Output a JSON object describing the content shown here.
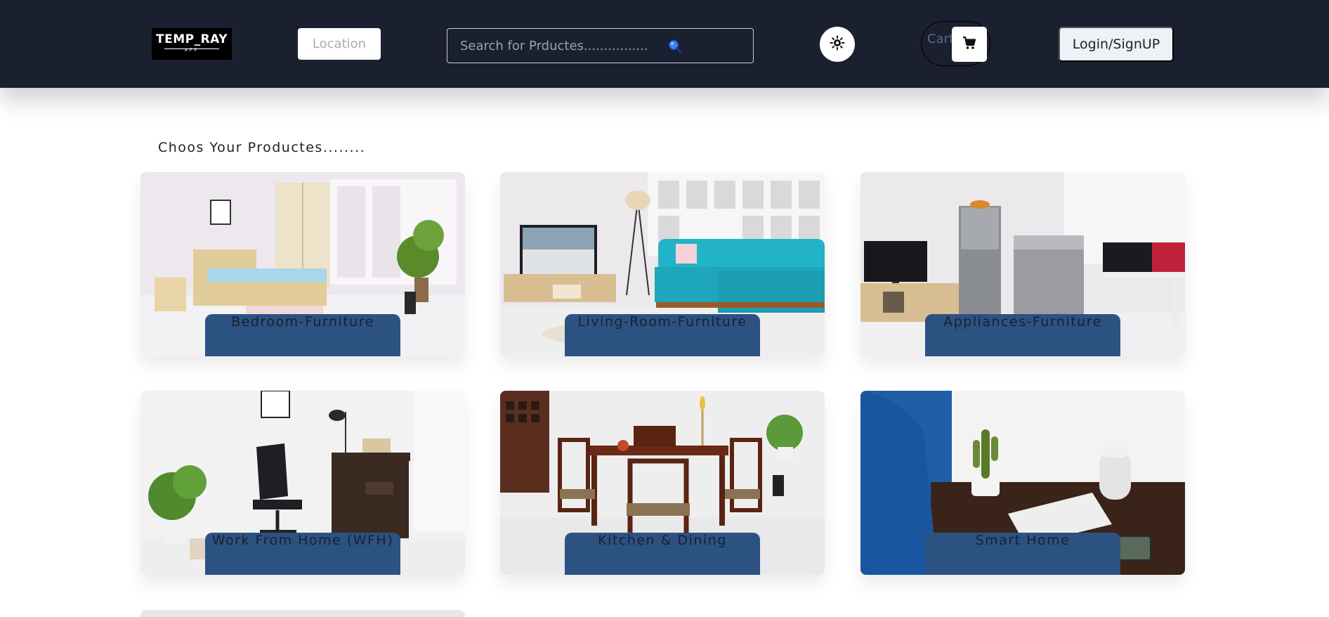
{
  "navbar": {
    "logo": {
      "text": "TEMP_RAY",
      "subtext": "APP"
    },
    "location_label": "Location",
    "search": {
      "placeholder": "Search for Prductes................",
      "icon": "search-icon"
    },
    "theme_icon": "sun-icon",
    "cart": {
      "label": "Cart",
      "icon": "cart-icon"
    },
    "login_label": "Login/SignUP"
  },
  "main": {
    "title": "Choos Your Productes........",
    "categories": [
      {
        "label": "Bedroom-Furniture"
      },
      {
        "label": "Living-Room-Furniture"
      },
      {
        "label": "Appliances-Furniture"
      },
      {
        "label": "Work From Home (WFH)"
      },
      {
        "label": "Kitchen & Dining"
      },
      {
        "label": "Smart Home"
      }
    ]
  },
  "colors": {
    "navbar_bg": "#1a2030",
    "label_bg": "#2c5282",
    "page_bg": "#ffffff"
  }
}
